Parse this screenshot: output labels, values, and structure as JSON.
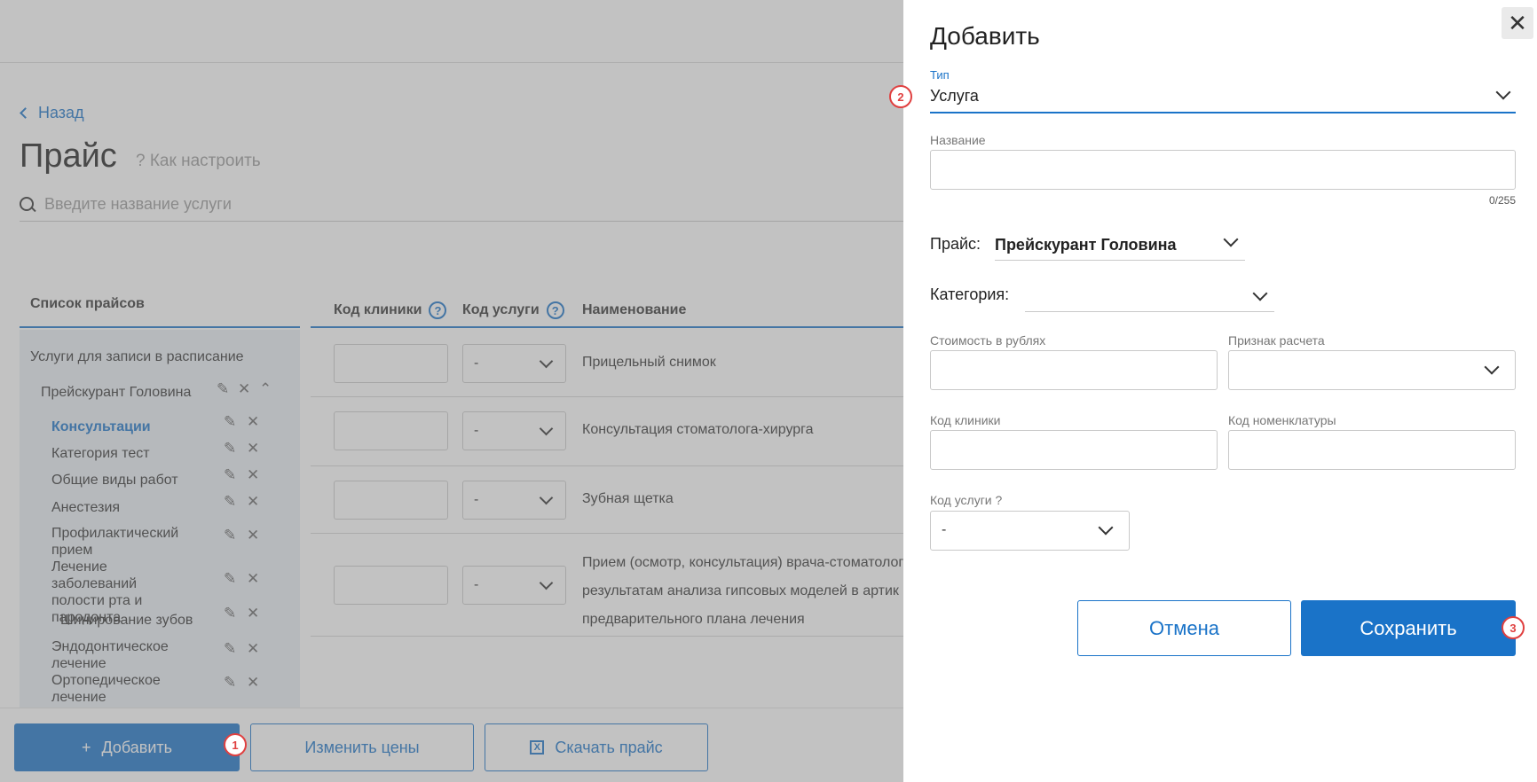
{
  "page": {
    "back_label": "Назад",
    "title": "Прайс",
    "howto_label": "? Как настроить",
    "search_placeholder": "Введите название услуги"
  },
  "price_list": {
    "header": "Список прайсов",
    "group": "Услуги для записи в расписание",
    "price_name": "Прейскурант Головина",
    "categories": [
      "Консультации",
      "Категория тест",
      "Общие виды работ",
      "Анестезия",
      "Профилактический прием",
      "Лечение заболеваний полости рта и пародонта",
      "Шинирование зубов",
      "Эндодонтическое лечение",
      "Ортопедическое лечение"
    ]
  },
  "table": {
    "col_clinic_code": "Код клиники",
    "col_service_code": "Код услуги",
    "col_name": "Наименование",
    "rows": [
      {
        "service_code": "-",
        "name": "Прицельный снимок"
      },
      {
        "service_code": "-",
        "name": "Консультация стоматолога-хирурга"
      },
      {
        "service_code": "-",
        "name": "Зубная щетка"
      },
      {
        "service_code": "-",
        "name_lines": [
          "Прием (осмотр, консультация) врача-стоматолог",
          "результатам анализа гипсовых моделей в артик",
          "предварительного плана лечения"
        ]
      }
    ]
  },
  "bottom": {
    "add_label": "Добавить",
    "change_prices_label": "Изменить цены",
    "download_label": "Скачать прайс"
  },
  "panel": {
    "title": "Добавить",
    "type_label": "Тип",
    "type_value": "Услуга",
    "name_label": "Название",
    "name_counter": "0/255",
    "price_label": "Прайс:",
    "price_value": "Прейскурант Головина",
    "category_label": "Категория:",
    "cost_label": "Стоимость в рублях",
    "calc_sign_label": "Признак расчета",
    "clinic_code_label": "Код клиники",
    "nomenclature_code_label": "Код номенклатуры",
    "service_code_label": "Код услуги ?",
    "service_code_value": "-",
    "cancel_label": "Отмена",
    "save_label": "Сохранить"
  },
  "badges": [
    "1",
    "2",
    "3"
  ],
  "colors": {
    "accent": "#1a73c8",
    "badge": "#e04040",
    "overlay": "#787878"
  }
}
